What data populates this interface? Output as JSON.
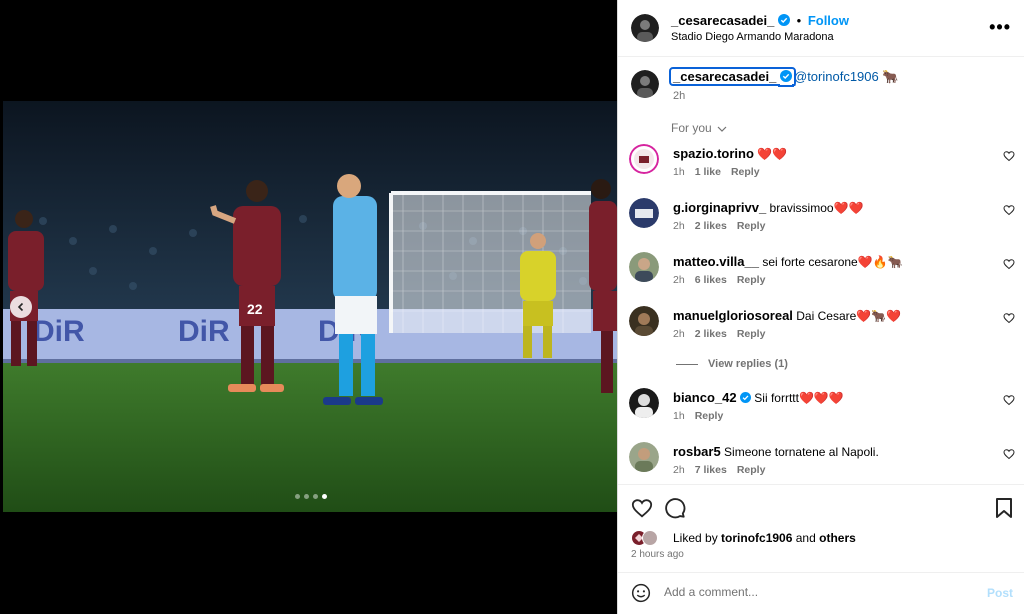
{
  "post": {
    "username": "_cesarecasadei_",
    "follow_label": "Follow",
    "separator": "•",
    "location": "Stadio Diego Armando Maradona",
    "more_label": "•••",
    "caption_tag": "@torinofc1906",
    "caption_emoji": "🐂",
    "caption_time": "2h",
    "carousel": {
      "total_slides": 4,
      "active_slide": 4
    }
  },
  "comments_filter": {
    "label": "For you"
  },
  "comments": [
    {
      "user": "spazio.torino",
      "text": "❤️❤️",
      "time": "1h",
      "likes": "1 like",
      "reply": "Reply"
    },
    {
      "user": "g.iorginaprivv_",
      "text": "bravissimoo❤️❤️",
      "time": "2h",
      "likes": "2 likes",
      "reply": "Reply"
    },
    {
      "user": "matteo.villa__",
      "text": "sei forte cesarone❤️🔥🐂",
      "time": "2h",
      "likes": "6 likes",
      "reply": "Reply"
    },
    {
      "user": "manuelgloriosoreal",
      "text": "Dai Cesare❤️🐂❤️",
      "time": "2h",
      "likes": "2 likes",
      "reply": "Reply"
    },
    {
      "user": "bianco_42",
      "text": "Sii forrttt❤️❤️❤️",
      "time": "1h",
      "likes": "",
      "reply": "Reply"
    },
    {
      "user": "rosbar5",
      "text": "Simeone tornatene al Napoli.",
      "time": "2h",
      "likes": "7 likes",
      "reply": "Reply"
    }
  ],
  "view_replies": "View replies (1)",
  "likes": {
    "prefix": "Liked by",
    "user": "torinofc1906",
    "and": "and",
    "others": "others",
    "time_ago": "2 hours ago"
  },
  "add_comment": {
    "placeholder": "Add a comment...",
    "post_label": "Post"
  },
  "colors": {
    "accent": "#0095f6",
    "torino": "#7a1f2b",
    "napoli": "#5bb2e6"
  }
}
